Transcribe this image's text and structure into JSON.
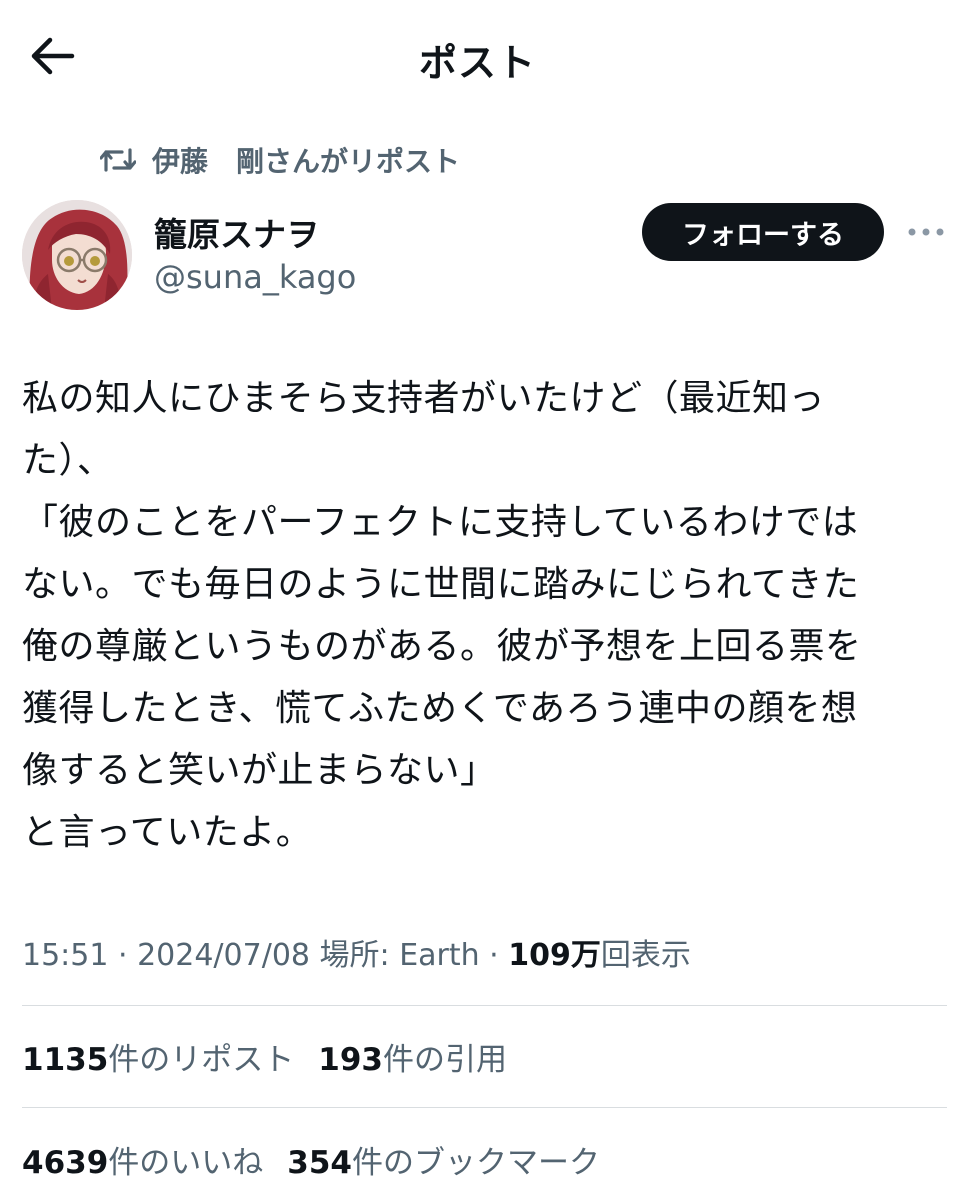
{
  "header": {
    "title": "ポスト",
    "back_icon": "back-arrow-icon"
  },
  "repost_context": {
    "text": "伊藤　剛さんがリポスト",
    "icon": "repost-icon"
  },
  "author": {
    "name": "籠原スナヲ",
    "handle": "@suna_kago",
    "avatar": "avatar-illustration",
    "follow_label": "フォローする",
    "more_icon": "more-options-icon"
  },
  "post": {
    "text": "私の知人にひまそら支持者がいたけど（最近知っ\nた）、\n「彼のことをパーフェクトに支持しているわけでは\nない。でも毎日のように世間に踏みにじられてきた\n俺の尊厳というものがある。彼が予想を上回る票を\n獲得したとき、慌てふためくであろう連中の顔を想\n像すると笑いが止まらない」\nと言っていたよ。"
  },
  "meta": {
    "time": "15:51",
    "date": "2024/07/08",
    "location": "場所: Earth",
    "views_count": "109万",
    "views_label": "回表示",
    "separator": " · "
  },
  "stats": {
    "reposts_count": "1135",
    "reposts_label": "件のリポスト",
    "quotes_count": "193",
    "quotes_label": "件の引用",
    "likes_count": "4639",
    "likes_label": "件のいいね",
    "bookmarks_count": "354",
    "bookmarks_label": "件のブックマーク"
  },
  "colors": {
    "text": "#0f1419",
    "secondary": "#536471",
    "divider": "#d9dde0",
    "follow_bg": "#0f1419"
  }
}
